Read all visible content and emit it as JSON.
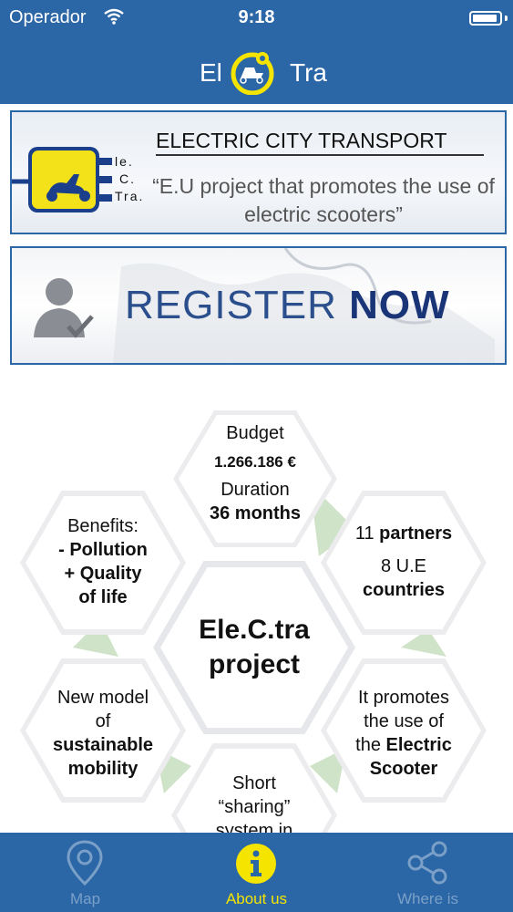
{
  "status_bar": {
    "carrier": "Operador",
    "time": "9:18"
  },
  "nav": {
    "logo_left": "El",
    "logo_right": "Tra"
  },
  "banner_info": {
    "plug_text": [
      "le.",
      "C.",
      "Tra."
    ],
    "title": "ELECTRIC CITY TRANSPORT",
    "subtitle": "“E.U project that promotes the use of electric scooters”"
  },
  "banner_register": {
    "text_a": "REGISTER",
    "text_b": "NOW"
  },
  "hexagons": {
    "center": {
      "line1": "Ele.C.tra",
      "line2": "project"
    },
    "top": {
      "l1": "Budget",
      "l2": "1.266.186 €",
      "l3": "Duration",
      "l4": "36 months"
    },
    "left_upper": {
      "l1": "Benefits:",
      "l2": "- Pollution",
      "l3": "+ Quality",
      "l4": "of life"
    },
    "right_upper": {
      "l1": "11",
      "l1b": "partners",
      "l2": "8 U.E",
      "l3": "countries"
    },
    "left_lower": {
      "l1": "New model",
      "l2": "of",
      "l3": "sustainable",
      "l4": "mobility"
    },
    "right_lower": {
      "l1": "It promotes",
      "l2": "the use of",
      "l3": "the",
      "l3b": "Electric",
      "l4": "Scooter"
    },
    "bottom": {
      "l1": "Short",
      "l2": "“sharing”",
      "l3": "system in"
    }
  },
  "tabs": [
    {
      "label": "Map",
      "icon": "map-pin-icon"
    },
    {
      "label": "About us",
      "icon": "info-icon"
    },
    {
      "label": "Where is",
      "icon": "share-icon"
    }
  ],
  "colors": {
    "bar": "#2b66a6",
    "active_tab": "#f5e400",
    "inactive_tab": "#7aa0c8"
  }
}
